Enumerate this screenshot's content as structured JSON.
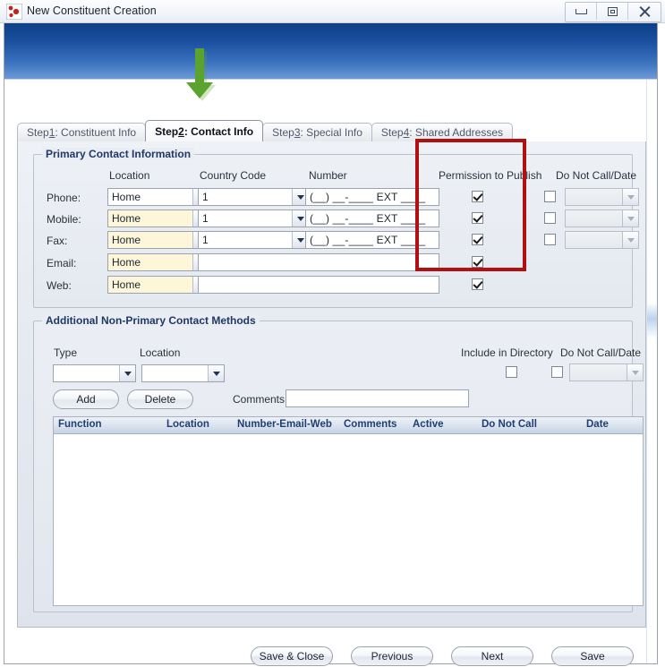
{
  "window": {
    "title": "New Constituent Creation",
    "icon": "app-dots-icon",
    "controls": {
      "minimize": "Minimize",
      "restore": "Restore",
      "close": "Close"
    }
  },
  "tabs": [
    {
      "id": "step1",
      "prefix": "Step ",
      "key": "1",
      "suffix": ": Constituent Info",
      "active": false
    },
    {
      "id": "step2",
      "prefix": "Step ",
      "key": "2",
      "suffix": ": Contact Info",
      "active": true
    },
    {
      "id": "step3",
      "prefix": "Step ",
      "key": "3",
      "suffix": ": Special Info",
      "active": false
    },
    {
      "id": "step4",
      "prefix": "Step ",
      "key": "4",
      "suffix": ": Shared Addresses",
      "active": false
    }
  ],
  "primary": {
    "legend": "Primary Contact Information",
    "columns": {
      "location": "Location",
      "country_code": "Country Code",
      "number": "Number",
      "permission": "Permission to Publish",
      "do_not_call": "Do Not Call/Date"
    },
    "number_mask": "(__)  __-____ EXT ____",
    "rows": [
      {
        "label": "Phone:",
        "location": "Home",
        "location_highlight": false,
        "country_code": "1",
        "has_country": true,
        "number": "(__)  __-____ EXT ____",
        "permission_checked": true,
        "dnc_checked": false,
        "has_dnc": true,
        "dnc_date": ""
      },
      {
        "label": "Mobile:",
        "location": "Home",
        "location_highlight": true,
        "country_code": "1",
        "has_country": true,
        "number": "(__)  __-____ EXT ____",
        "permission_checked": true,
        "dnc_checked": false,
        "has_dnc": true,
        "dnc_date": ""
      },
      {
        "label": "Fax:",
        "location": "Home",
        "location_highlight": true,
        "country_code": "1",
        "has_country": true,
        "number": "(__)  __-____ EXT ____",
        "permission_checked": true,
        "dnc_checked": false,
        "has_dnc": true,
        "dnc_date": ""
      },
      {
        "label": "Email:",
        "location": "Home",
        "location_highlight": true,
        "country_code": "",
        "has_country": false,
        "number": "",
        "permission_checked": true,
        "dnc_checked": false,
        "has_dnc": false,
        "dnc_date": ""
      },
      {
        "label": "Web:",
        "location": "Home",
        "location_highlight": true,
        "country_code": "",
        "has_country": false,
        "number": "",
        "permission_checked": true,
        "dnc_checked": false,
        "has_dnc": false,
        "dnc_date": ""
      }
    ]
  },
  "additional": {
    "legend": "Additional Non-Primary Contact Methods",
    "type_label": "Type",
    "location_label": "Location",
    "type_value": "",
    "location_value": "",
    "include_directory_label": "Include in Directory",
    "include_directory_checked": false,
    "do_not_call_label": "Do Not Call/Date",
    "do_not_call_checked": false,
    "do_not_call_date": "",
    "add_button": "Add",
    "delete_button": "Delete",
    "comments_label": "Comments",
    "comments_value": "",
    "grid": {
      "headers": [
        "Function",
        "Location",
        "Number-Email-Web",
        "Comments",
        "Active",
        "Do Not Call",
        "Date"
      ],
      "rows": []
    }
  },
  "footer": {
    "buttons": [
      "Save & Close",
      "Previous",
      "Next",
      "Save"
    ]
  },
  "annotations": {
    "highlight_box": {
      "target": "Permission to Publish",
      "color": "#b20f13"
    },
    "arrow": {
      "target": "Step 2: Contact Info",
      "color": "#5aa32e",
      "direction": "down"
    }
  }
}
